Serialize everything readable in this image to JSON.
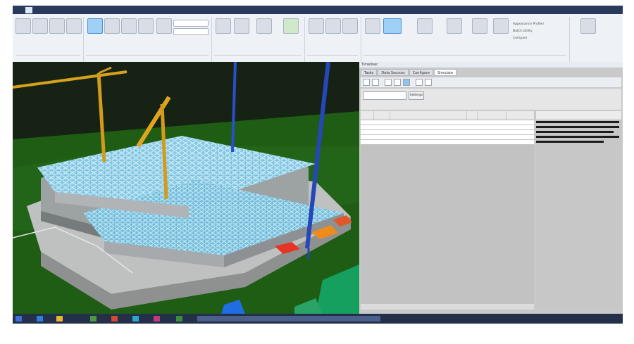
{
  "titlebar": {
    "tabs": [
      {
        "label": "",
        "active": false
      },
      {
        "label": "",
        "active": true
      },
      {
        "label": "",
        "active": false
      },
      {
        "label": "",
        "active": false
      },
      {
        "label": "",
        "active": false
      },
      {
        "label": "",
        "active": false
      },
      {
        "label": "",
        "active": false
      },
      {
        "label": "",
        "active": false
      }
    ]
  },
  "ribbon": {
    "right_items": [
      "Appearance Profiler",
      "Batch Utility",
      "Compare"
    ]
  },
  "panel": {
    "title": "Timeliner",
    "tabs": [
      "Tasks",
      "Data Sources",
      "Configure",
      "Simulate"
    ],
    "active_tab": "Simulate",
    "filter_button": "Settings",
    "grid": {
      "rows": [
        {
          "bold": true,
          "text": ""
        },
        {
          "bold": false,
          "text": ""
        },
        {
          "bold": false,
          "text": ""
        },
        {
          "bold": false,
          "text": ""
        },
        {
          "bold": false,
          "text": ""
        }
      ]
    }
  },
  "colors": {
    "ground": "#1d5a12",
    "steel": "#8ccfe9",
    "crane": "#d39a1c",
    "blue_mast": "#2a4fc9",
    "red_pad": "#e53527",
    "orange_pad": "#ee8b1d",
    "taskbar": "#24304a",
    "panel_bg": "#c9c9c9"
  },
  "icons": [
    "undo-icon",
    "redo-icon",
    "select-icon",
    "walk-icon",
    "timeliner-icon",
    "clash-icon",
    "windows-start-icon"
  ]
}
